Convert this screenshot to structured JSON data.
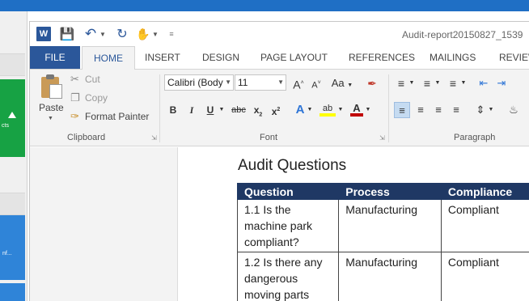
{
  "background": {
    "green_tile_label": "cts",
    "blue_tile_label": "nf..."
  },
  "quick_access": {
    "word_icon": "W",
    "save_icon": "save-icon",
    "undo_icon": "undo-icon",
    "redo_icon": "redo-icon",
    "touch_icon": "touch-mode-icon"
  },
  "document_title": "Audit-report20150827_1539",
  "tabs": [
    "FILE",
    "HOME",
    "INSERT",
    "DESIGN",
    "PAGE LAYOUT",
    "REFERENCES",
    "MAILINGS",
    "REVIEW"
  ],
  "clipboard": {
    "paste_label": "Paste",
    "cut_label": "Cut",
    "copy_label": "Copy",
    "format_painter_label": "Format Painter",
    "group_label": "Clipboard"
  },
  "font": {
    "font_name": "Calibri (Body",
    "font_size": "11",
    "grow": "A",
    "shrink": "A",
    "change_case": "Aa",
    "bold": "B",
    "italic": "I",
    "underline": "U",
    "strikethrough": "abc",
    "subscript": "x",
    "superscript": "x",
    "text_effects": "A",
    "highlight": "ab",
    "font_color": "A",
    "group_label": "Font"
  },
  "paragraph": {
    "group_label": "Paragraph"
  },
  "document": {
    "heading": "Audit Questions",
    "table": {
      "headers": [
        "Question",
        "Process",
        "Compliance"
      ],
      "rows": [
        [
          "1.1 Is the machine park compliant?",
          "Manufacturing",
          "Compliant"
        ],
        [
          "1.2 Is there any dangerous moving parts",
          "Manufacturing",
          "Compliant"
        ]
      ]
    }
  },
  "colors": {
    "accent": "#2b579a",
    "table_header": "#1f3864",
    "taskbar_blue": "#1f6fc5"
  }
}
